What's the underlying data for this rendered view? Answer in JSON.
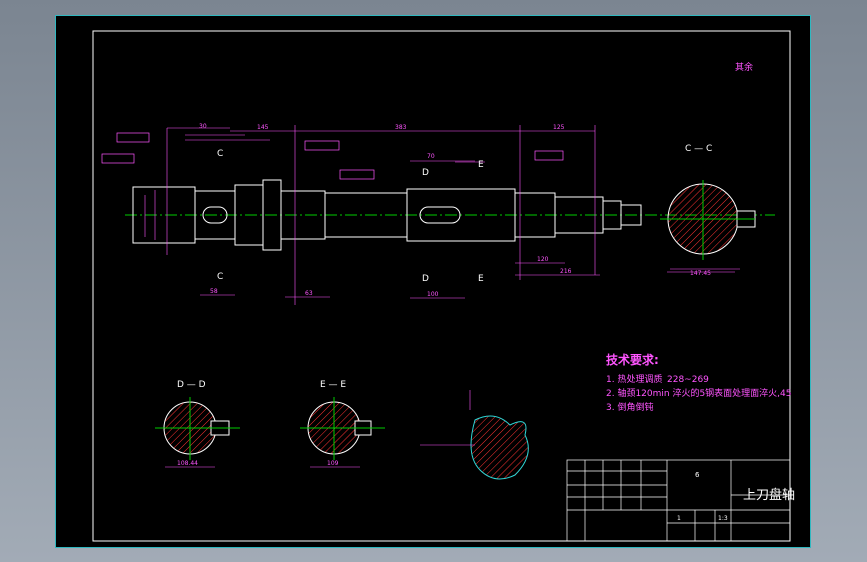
{
  "drawing": {
    "part_name": "上刀盘轴",
    "remainder_mark": "其余",
    "tech_req": {
      "title": "技术要求:",
      "items": [
        "1. 热处理调质",
        "2. 轴颈120min 淬火的5钢表面处理面淬火,45",
        "3. 倒角倒钝"
      ],
      "hardness": "228~269"
    },
    "section_labels": {
      "c": "C — C",
      "d": "D — D",
      "e": "E — E",
      "c_top": "C",
      "c_bottom": "C",
      "d_top": "D",
      "d_bottom": "D",
      "e_top": "E",
      "e_bottom": "E"
    },
    "dimensions": {
      "d1": "30",
      "d2": "145",
      "d3": "383",
      "d4": "125",
      "d5": "70",
      "d6": "120",
      "d7": "216",
      "d8": "58",
      "d9": "63",
      "d10": "100",
      "d11": "147.45",
      "d12": "108.44",
      "d13": "109"
    },
    "title_block": {
      "scale": "1:3",
      "quantity": "1",
      "drawing_no": "6"
    }
  },
  "colors": {
    "outline": "#ffffff",
    "dimension": "#ff55ff",
    "centerline": "#00cc00",
    "hatch": "#ff3333",
    "border": "#2fb8c0",
    "sheet": "#000000"
  }
}
